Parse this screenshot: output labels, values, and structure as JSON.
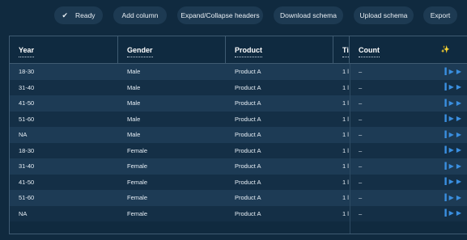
{
  "toolbar": {
    "ready": "Ready",
    "add_column": "Add column",
    "expand_collapse": "Expand/Collapse headers",
    "download_schema": "Download schema",
    "upload_schema": "Upload schema",
    "export": "Export"
  },
  "table": {
    "headers": {
      "year": "Year",
      "gender": "Gender",
      "product": "Product",
      "ti": "Ti",
      "count": "Count"
    },
    "rows": [
      {
        "year": "18-30",
        "gender": "Male",
        "product": "Product A",
        "ti": "1 l",
        "count": "–"
      },
      {
        "year": "31-40",
        "gender": "Male",
        "product": "Product A",
        "ti": "1 l",
        "count": "–"
      },
      {
        "year": "41-50",
        "gender": "Male",
        "product": "Product A",
        "ti": "1 l",
        "count": "–"
      },
      {
        "year": "51-60",
        "gender": "Male",
        "product": "Product A",
        "ti": "1 l",
        "count": "–"
      },
      {
        "year": "NA",
        "gender": "Male",
        "product": "Product A",
        "ti": "1 l",
        "count": "–"
      },
      {
        "year": "18-30",
        "gender": "Female",
        "product": "Product A",
        "ti": "1 l",
        "count": "–"
      },
      {
        "year": "31-40",
        "gender": "Female",
        "product": "Product A",
        "ti": "1 l",
        "count": "–"
      },
      {
        "year": "41-50",
        "gender": "Female",
        "product": "Product A",
        "ti": "1 l",
        "count": "–"
      },
      {
        "year": "51-60",
        "gender": "Female",
        "product": "Product A",
        "ti": "1 l",
        "count": "–"
      },
      {
        "year": "NA",
        "gender": "Female",
        "product": "Product A",
        "ti": "1 l",
        "count": "–"
      }
    ]
  },
  "icons": {
    "ready": "check-icon",
    "count_header": "sparkle-icon",
    "row_step": "step-forward-icon",
    "row_play": "play-icon"
  },
  "colors": {
    "background": "#102a3f",
    "button_bg": "#1d3a52",
    "row_even": "#1d3b55",
    "row_odd": "#142f46",
    "accent": "#3a8fe0"
  }
}
